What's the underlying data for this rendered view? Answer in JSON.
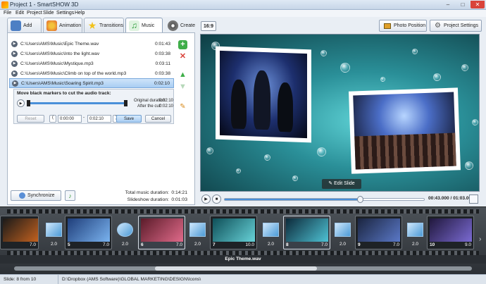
{
  "window": {
    "title": "Project 1 - SmartSHOW 3D",
    "minimize": "–",
    "maximize": "□",
    "close": "✕"
  },
  "menu": [
    "File",
    "Edit",
    "Project",
    "Slide",
    "Settings",
    "Help"
  ],
  "tabs": [
    {
      "label": "Add",
      "icon": "add-photo-icon",
      "color": "#4d7fc4"
    },
    {
      "label": "Animation",
      "icon": "palette-icon",
      "color": "#e18a2b"
    },
    {
      "label": "Transitions",
      "icon": "star-icon",
      "color": "#f2c21b"
    },
    {
      "label": "Music",
      "icon": "music-note-icon",
      "color": "#3fae49",
      "active": true
    },
    {
      "label": "Create",
      "icon": "film-reel-icon",
      "color": "#555555"
    }
  ],
  "tracks": [
    {
      "path": "C:\\Users\\AMS\\Music\\Epic Theme.wav",
      "duration": "0:01:43"
    },
    {
      "path": "C:\\Users\\AMS\\Music\\Into the light.wav",
      "duration": "0:03:38"
    },
    {
      "path": "C:\\Users\\AMS\\Music\\Mystique.mp3",
      "duration": "0:03:11"
    },
    {
      "path": "C:\\Users\\AMS\\Music\\Climb on top of the world.mp3",
      "duration": "0:03:38"
    },
    {
      "path": "C:\\Users\\AMS\\Music\\Soaring Spirit.mp3",
      "duration": "0:02:10",
      "selected": true
    }
  ],
  "editor": {
    "title": "Move black markers to cut the audio track:",
    "original_label": "Original duration:",
    "original_value": "0:02:10",
    "after_label": "After the cut:",
    "after_value": "0:02:10",
    "reset": "Reset",
    "start_time": "0:00:00",
    "end_time": "0:02:10",
    "save": "Save",
    "cancel": "Cancel"
  },
  "sync_button": "Synchronize",
  "totals": {
    "music_label": "Total music duration:",
    "music_value": "0:14:21",
    "slideshow_label": "Slideshow duration:",
    "slideshow_value": "0:01:03"
  },
  "toolbar": {
    "ratio": "16:9",
    "photo_position": "Photo Position",
    "project_settings": "Project Settings"
  },
  "preview": {
    "edit_slide": "Edit Slide"
  },
  "player": {
    "timecode": "00:43.000 / 01:03.000",
    "progress": 0.68
  },
  "timeline": {
    "slides": [
      {
        "num": "",
        "duration": "7.0"
      },
      {
        "num": "5",
        "duration": "7.0"
      },
      {
        "num": "6",
        "duration": "7.0",
        "selected": true
      },
      {
        "num": "7",
        "duration": "10.0"
      },
      {
        "num": "8",
        "duration": "7.0"
      },
      {
        "num": "9",
        "duration": "7.0"
      },
      {
        "num": "10",
        "duration": "9.0"
      }
    ],
    "transitions": [
      "2.0",
      "2.0",
      "2.0",
      "2.0",
      "2.0",
      "2.0"
    ],
    "audio_label": "Epic Theme.wav"
  },
  "status": {
    "slide_info": "Slide: 8 from 10",
    "path": "D:\\Dropbox (AMS Software)\\GLOBAL MARKETING\\DESIGN\\Icons\\"
  }
}
